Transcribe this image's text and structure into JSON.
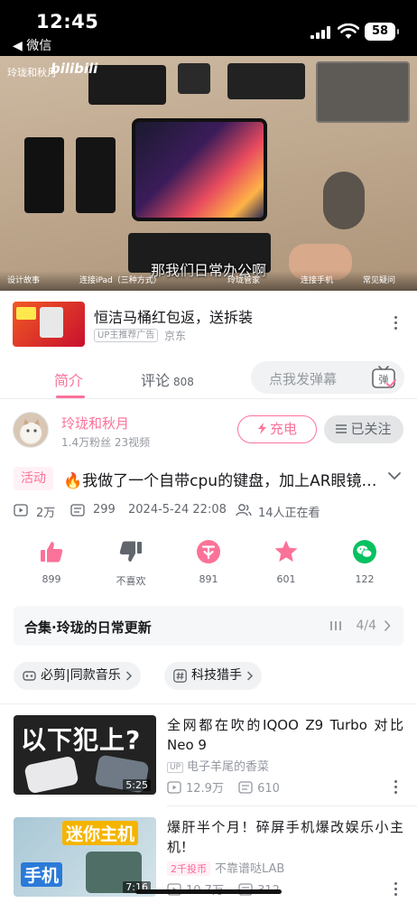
{
  "status_bar": {
    "time": "12:45",
    "back_label": "◀ 微信",
    "battery": "58"
  },
  "video": {
    "uploader_watermark": "玲珑和秋月",
    "brand_watermark": "bilibili",
    "subtitle": "那我们日常办公啊",
    "chapters": [
      "设计故事",
      "连接iPad（三种方式）",
      "玲珑管家",
      "连接手机",
      "常见疑问"
    ]
  },
  "ad": {
    "title": "恒洁马桶红包返，送拆装",
    "tag": "UP主推荐广告",
    "source": "京东"
  },
  "tabs": {
    "intro": "简介",
    "comments": "评论",
    "comment_count": "808",
    "danmaku_placeholder": "点我发弹幕",
    "danmaku_btn": "弹"
  },
  "uploader": {
    "name": "玲珑和秋月",
    "stats": "1.4万粉丝  23视频",
    "charge_label": "充电",
    "follow_label": "已关注"
  },
  "video_info": {
    "tag": "活动",
    "title": "🔥我做了一个自带cpu的键盘，加上AR眼镜就是一台电脑",
    "views": "2万",
    "danmaku": "299",
    "date": "2024-5-24 22:08",
    "watching": "14人正在看"
  },
  "actions": [
    {
      "label": "899",
      "icon": "thumbs-up-icon"
    },
    {
      "label": "不喜欢",
      "icon": "thumbs-down-icon"
    },
    {
      "label": "891",
      "icon": "coin-icon"
    },
    {
      "label": "601",
      "icon": "star-icon"
    },
    {
      "label": "122",
      "icon": "wechat-icon"
    }
  ],
  "collection": {
    "title": "合集·玲珑的日常更新",
    "progress": "4/4"
  },
  "chips": [
    {
      "label": "必剪|同款音乐"
    },
    {
      "label": "科技猎手"
    }
  ],
  "recommended": [
    {
      "title": "全网都在吹的IQOO Z9 Turbo 对比Neo 9",
      "thumb_text": "以下犯上?",
      "duration": "5:25",
      "badge": "UP",
      "uploader": "电子羊尾的香菜",
      "views": "12.9万",
      "danmaku": "610"
    },
    {
      "title": "爆肝半个月！碎屏手机爆改娱乐小主机！",
      "thumb_text_1": "迷你主机",
      "thumb_text_2": "手机",
      "duration": "7:16",
      "badge": "2千投币",
      "uploader": "不靠谱哒LAB",
      "views": "10.7万",
      "danmaku": "312"
    }
  ],
  "colors": {
    "accent": "#fb7299",
    "text_secondary": "#9499a0",
    "wechat": "#07c160"
  }
}
